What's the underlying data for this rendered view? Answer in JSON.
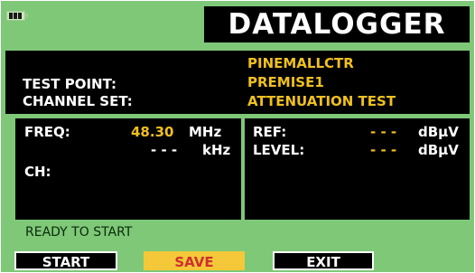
{
  "header": {
    "title": "DATALOGGER",
    "battery_icon": "battery-icon"
  },
  "info": {
    "site_name": "PINEMALLCTR",
    "test_point_label": "TEST POINT:",
    "test_point_value": "PREMISE1",
    "channel_set_label": "CHANNEL SET:",
    "channel_set_value": "ATTENUATION TEST"
  },
  "left_panel": {
    "freq_label": "FREQ:",
    "freq_value": "48.30",
    "freq_unit": "MHz",
    "offset_value": "- - -",
    "offset_unit": "kHz",
    "ch_label": "CH:"
  },
  "right_panel": {
    "ref_label": "REF:",
    "ref_value": "- - -",
    "ref_unit": "dBµV",
    "level_label": "LEVEL:",
    "level_value": "- - -",
    "level_unit": "dBµV"
  },
  "status_text": "READY TO START",
  "buttons": {
    "start": "START",
    "save": "SAVE",
    "exit": "EXIT"
  },
  "colors": {
    "background": "#7ec878",
    "panel": "#000000",
    "accent_yellow": "#f0c020",
    "save_button": "#f4c838",
    "save_text": "#cc3030"
  }
}
